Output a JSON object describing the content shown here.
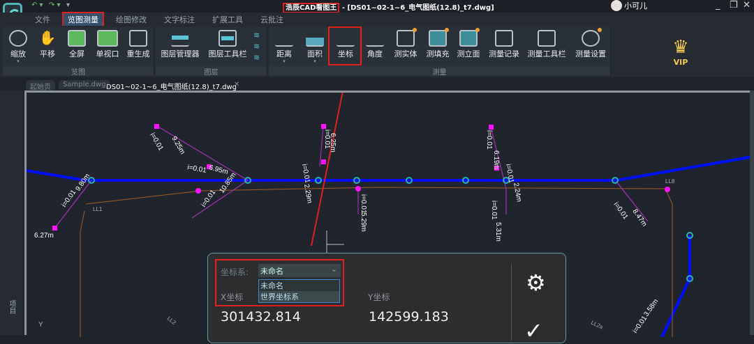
{
  "app": {
    "title": "浩辰CAD看图王",
    "document": " - [DS01~02-1~6_电气图纸(12.8)_t7.dwg]",
    "user": "小可儿"
  },
  "menu": [
    "文件",
    "览图测量",
    "绘图修改",
    "文字标注",
    "扩展工具",
    "云批注"
  ],
  "ribbon": {
    "view": {
      "label": "览图",
      "buttons": [
        "缩放",
        "平移",
        "全屏",
        "单视口",
        "重生成"
      ]
    },
    "layer": {
      "label": "图层",
      "buttons": [
        "图层管理器",
        "图层工具栏"
      ]
    },
    "measure": {
      "label": "测量",
      "buttons": [
        "距离",
        "面积",
        "坐标",
        "角度",
        "测实体",
        "测填充",
        "测立面",
        "测量记录",
        "测量工具栏",
        "测量设置"
      ]
    }
  },
  "vip": "VIP",
  "doc_tabs": [
    "起始页",
    "Sample.dwg",
    "DS01~02-1~6_电气图纸(12.8)_t7.dwg"
  ],
  "side_label": "项目",
  "drawing_labels": [
    "i=0.01",
    "9.25m",
    "i=0.01",
    "6.95m",
    "i=0.01",
    "10.85m",
    "i=0.01",
    "9.80m",
    "6.27m",
    "i=0.01",
    "6.25m",
    "i=0.01",
    "2.29m",
    "i=0.01",
    "5.29m",
    "i=0.01",
    "6.19m",
    "i=0.01",
    "2.24m",
    "i=0.01",
    "5.31m",
    "i=0.01",
    "8.47m",
    "i=0.01",
    "3.58m",
    "LL8",
    "LL1",
    "LL2",
    "LL2a",
    "Y"
  ],
  "coord_panel": {
    "system_label": "坐标系:",
    "selected": "未命名",
    "options": [
      "未命名",
      "世界坐标系"
    ],
    "x_label": "X坐标",
    "y_label": "Y坐标",
    "x_value": "301432.814",
    "y_value": "142599.183"
  },
  "colors": {
    "accent": "#34506a",
    "highlight": "#e02020",
    "pipe": "#0000ff"
  }
}
